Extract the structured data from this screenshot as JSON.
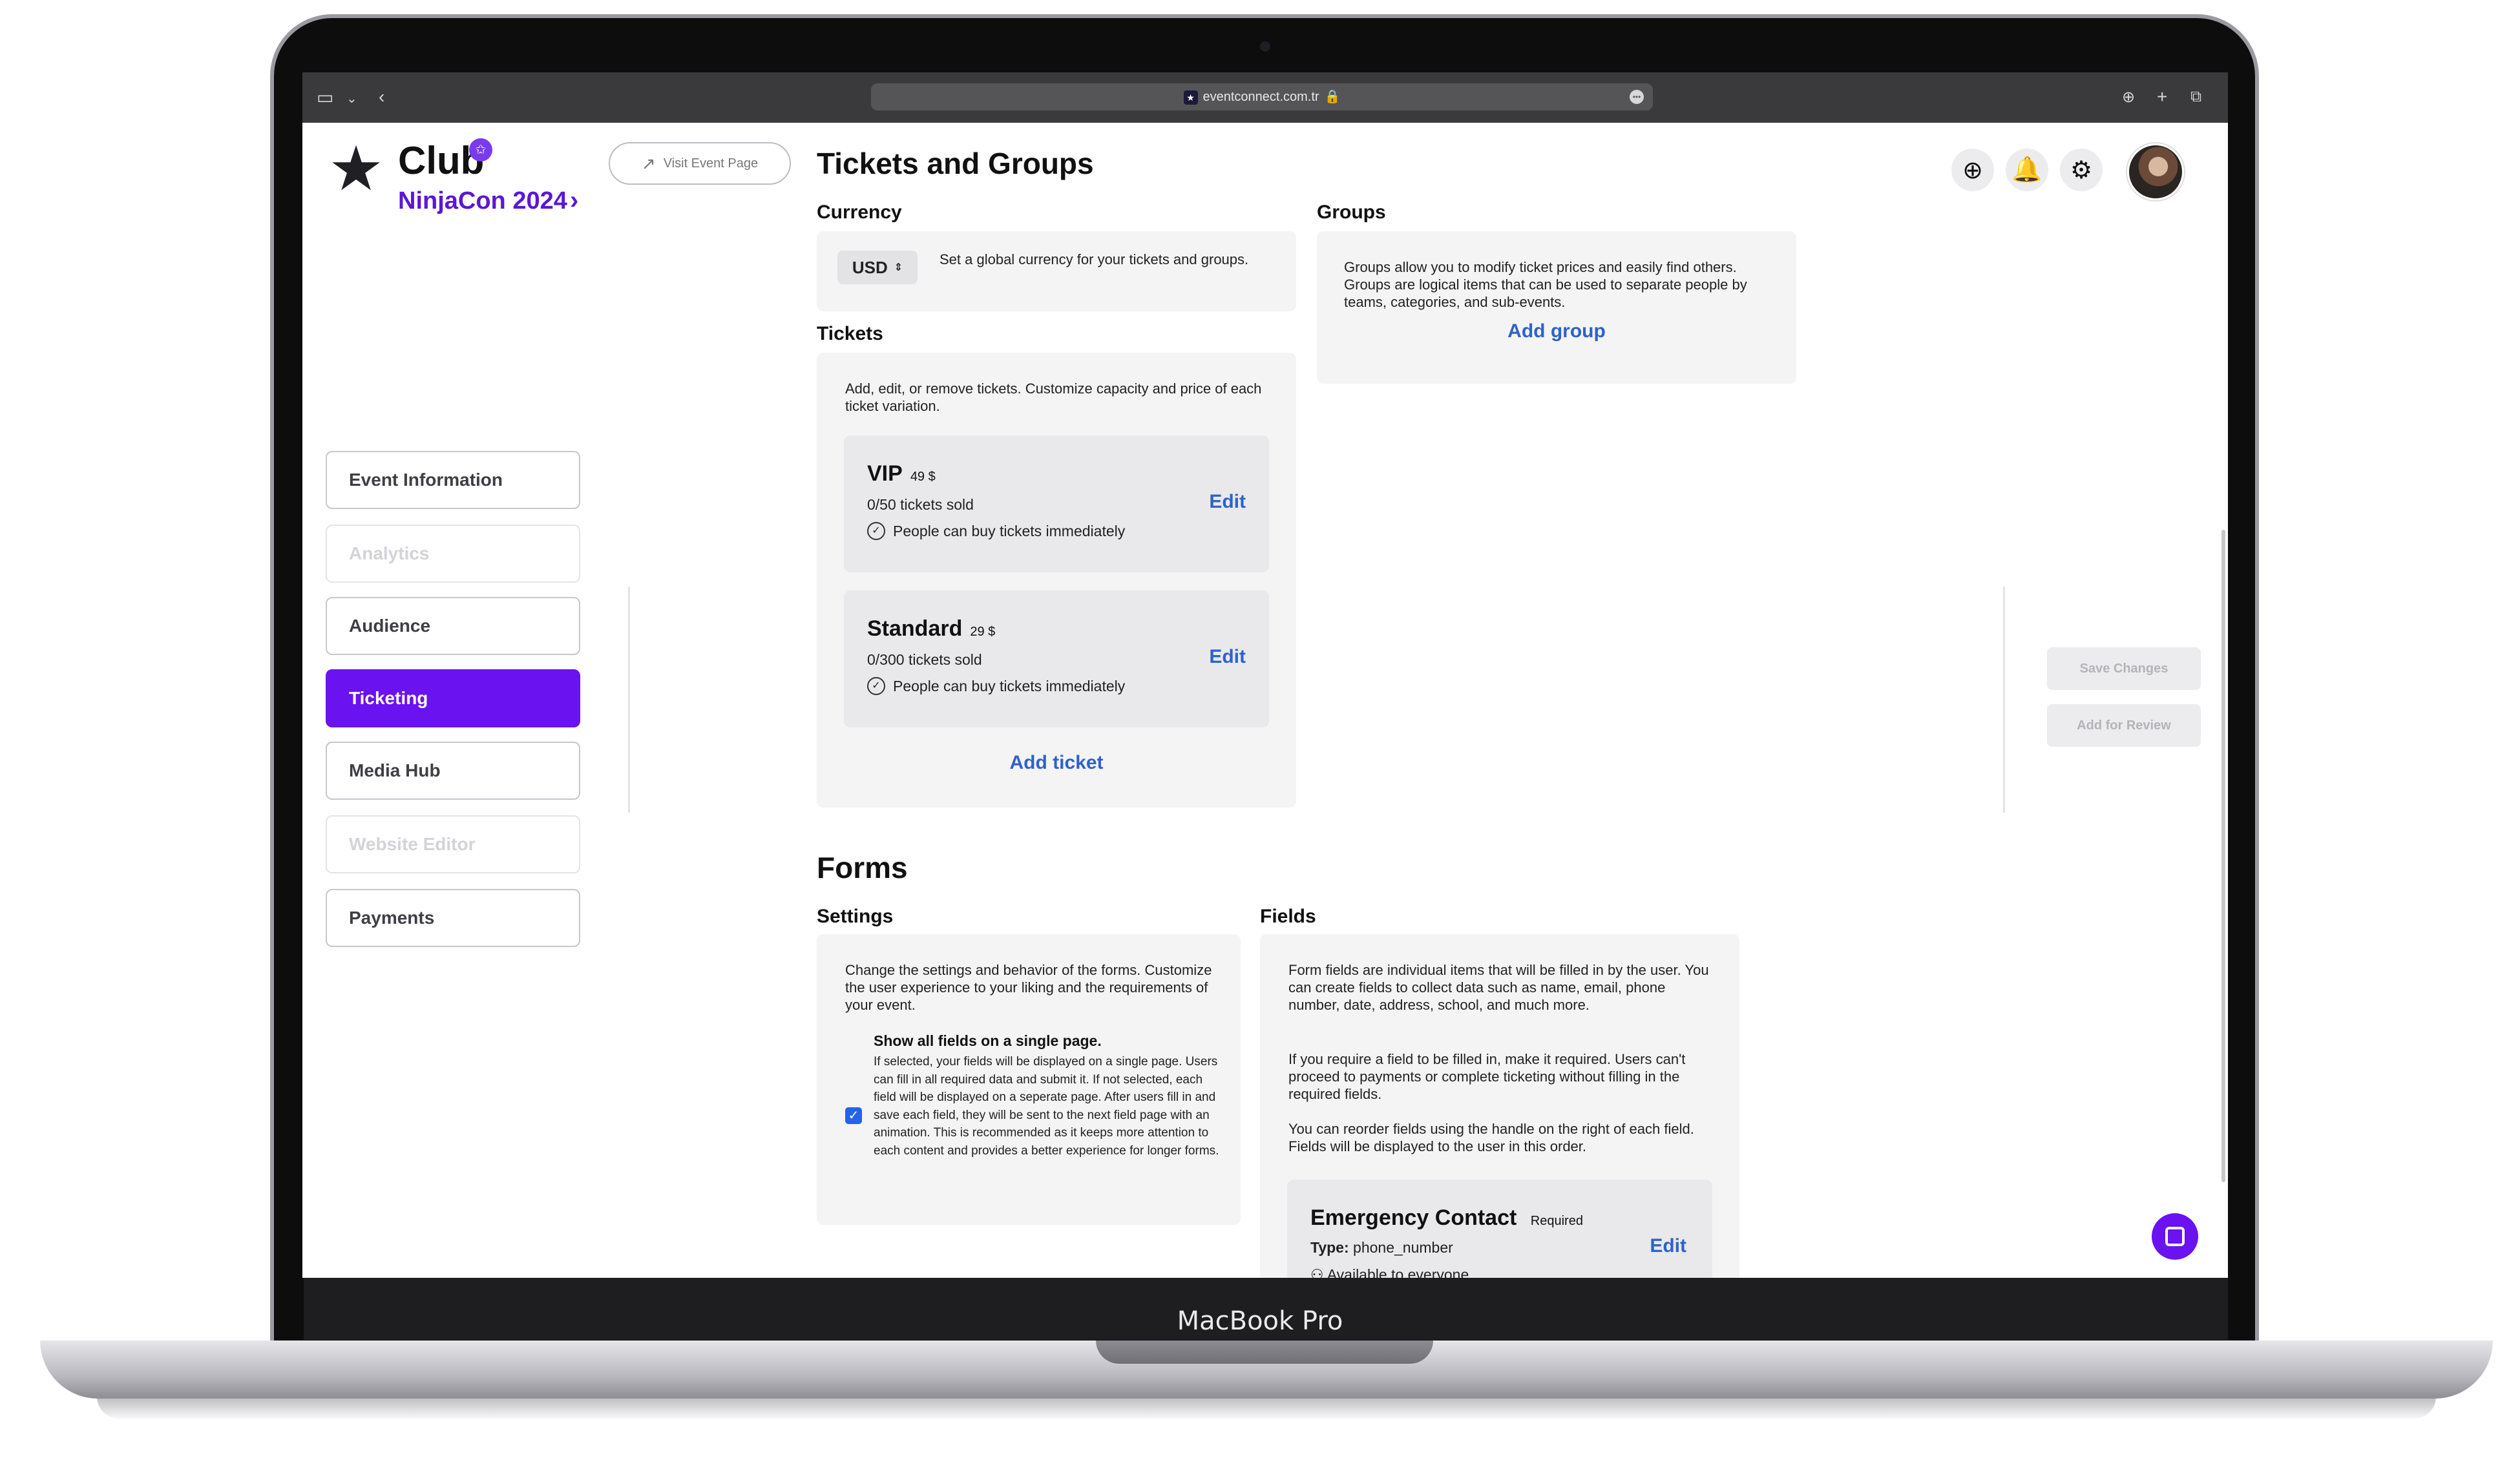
{
  "device": {
    "label": "MacBook Pro"
  },
  "browser": {
    "url": "eventconnect.com.tr"
  },
  "sidebar": {
    "logo_title": "Club",
    "event_name": "NinjaCon 2024",
    "visit_label": "Visit Event Page",
    "items": [
      {
        "label": "Event Information",
        "state": "normal"
      },
      {
        "label": "Analytics",
        "state": "disabled"
      },
      {
        "label": "Audience",
        "state": "normal"
      },
      {
        "label": "Ticketing",
        "state": "active"
      },
      {
        "label": "Media Hub",
        "state": "normal"
      },
      {
        "label": "Website Editor",
        "state": "disabled"
      },
      {
        "label": "Payments",
        "state": "normal"
      }
    ]
  },
  "main": {
    "title": "Tickets and Groups",
    "currency": {
      "heading": "Currency",
      "value": "USD",
      "description": "Set a global currency for your tickets and groups."
    },
    "groups": {
      "heading": "Groups",
      "description": "Groups allow you to modify ticket prices and easily find others. Groups are logical items that can be used to separate people by teams, categories, and sub-events.",
      "add_label": "Add group"
    },
    "tickets": {
      "heading": "Tickets",
      "description": "Add, edit, or remove tickets. Customize capacity and price of each ticket variation.",
      "items": [
        {
          "name": "VIP",
          "price": "49 $",
          "sold": "0/50 tickets sold",
          "status": "People can buy tickets immediately",
          "edit_label": "Edit"
        },
        {
          "name": "Standard",
          "price": "29 $",
          "sold": "0/300 tickets sold",
          "status": "People can buy tickets immediately",
          "edit_label": "Edit"
        }
      ],
      "add_label": "Add ticket"
    },
    "forms": {
      "title": "Forms",
      "settings": {
        "heading": "Settings",
        "description": "Change the settings and behavior of the forms. Customize the user experience to your liking and the requirements of your event.",
        "option_title": "Show all fields on a single page.",
        "option_description": "If selected, your fields will be displayed on a single page. Users can fill in all required data and submit it. If not selected, each field will be displayed on a seperate page. After users fill in and save each field, they will be sent to the next field page with an animation. This is recommended as it keeps more attention to each content and provides a better experience for longer forms.",
        "checked": true
      },
      "fields": {
        "heading": "Fields",
        "p1": "Form fields are individual items that will be filled in by the user. You can create fields to collect data such as name, email, phone number, date, address, school, and much more.",
        "p2": "If you require a field to be filled in, make it required. Users can't proceed to payments or complete ticketing without filling in the required fields.",
        "p3": "You can reorder fields using the handle on the right of each field. Fields will be displayed to the user in this order.",
        "item": {
          "name": "Emergency Contact",
          "badge": "Required",
          "type_label": "Type:",
          "type_value": "phone_number",
          "availability": "Available to everyone",
          "edit_label": "Edit"
        }
      }
    }
  },
  "actions": {
    "save_label": "Save Changes",
    "review_label": "Add for Review"
  },
  "icons": {
    "add": "plus-circle-icon",
    "notifications": "bell-icon",
    "settings": "gear-icon",
    "chat": "chat-icon"
  },
  "colors": {
    "accent": "#6a12f0",
    "link": "#2f62c9",
    "card": "#f4f4f5"
  }
}
